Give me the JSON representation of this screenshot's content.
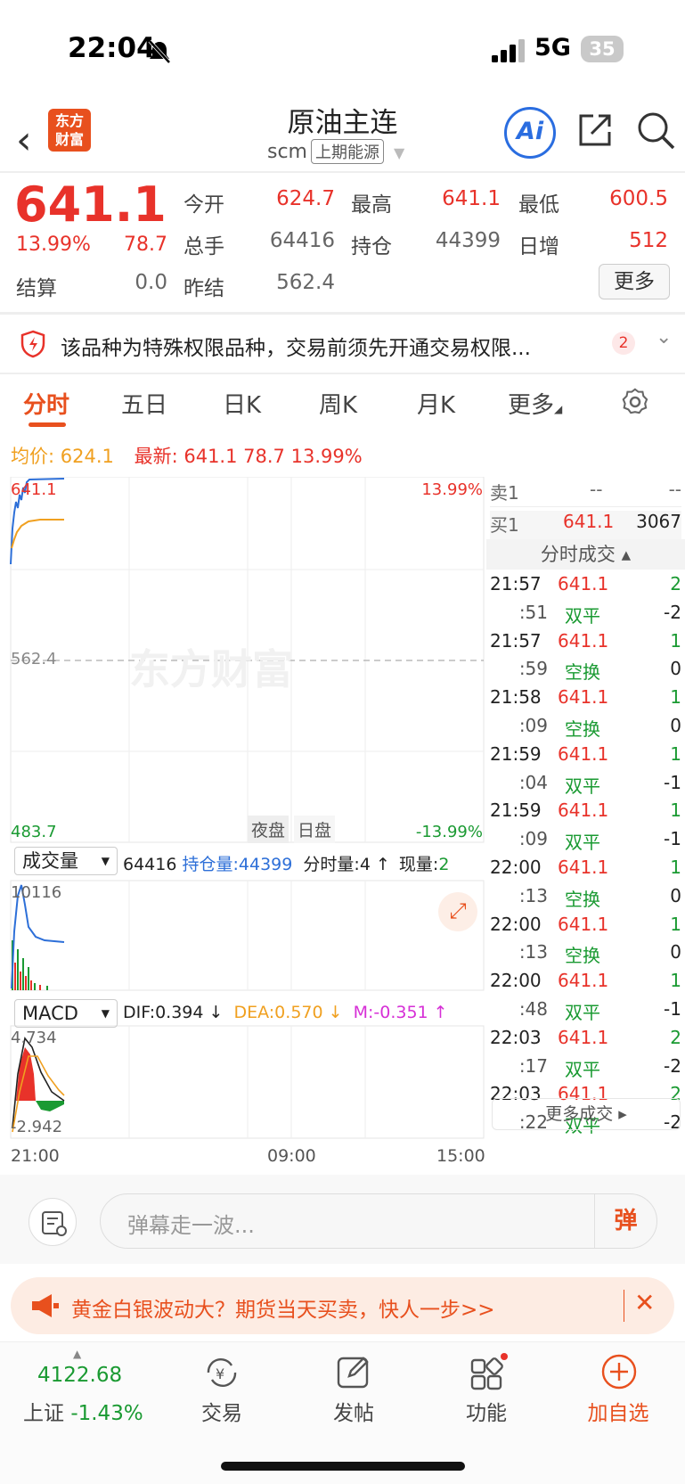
{
  "status_bar": {
    "time": "22:04",
    "network": "5G",
    "battery": "35"
  },
  "header": {
    "logo_text": "东方财富",
    "title": "原油主连",
    "symbol": "scm",
    "exchange": "上期能源"
  },
  "quote": {
    "price": "641.1",
    "change_pct": "13.99%",
    "change": "78.7",
    "fields": [
      {
        "label": "今开",
        "value": "624.7",
        "color": "red"
      },
      {
        "label": "最高",
        "value": "641.1",
        "color": "red"
      },
      {
        "label": "最低",
        "value": "600.5",
        "color": "red"
      },
      {
        "label": "总手",
        "value": "64416",
        "color": "gray"
      },
      {
        "label": "持仓",
        "value": "44399",
        "color": "gray"
      },
      {
        "label": "日增",
        "value": "512",
        "color": "red"
      },
      {
        "label": "结算",
        "value": "0.0",
        "color": "gray"
      },
      {
        "label": "昨结",
        "value": "562.4",
        "color": "gray"
      }
    ],
    "more_label": "更多"
  },
  "notice": {
    "text": "该品种为特殊权限品种，交易前须先开通交易权限...",
    "badge": "2"
  },
  "tabs": [
    "分时",
    "五日",
    "日K",
    "周K",
    "月K",
    "更多"
  ],
  "info_line": {
    "avg_label": "均价:",
    "avg_value": "624.1",
    "latest_label": "最新:",
    "latest_value": "641.1",
    "latest_change": "78.7",
    "latest_pct": "13.99%"
  },
  "chart": {
    "price_high": "641.1",
    "pct_high": "13.99%",
    "pre_settle": "562.4",
    "price_low": "483.7",
    "pct_low": "-13.99%",
    "watermark": "东方财富",
    "session_night": "夜盘",
    "session_day": "日盘",
    "volume_selector": "成交量",
    "volume_line": {
      "total": "64416",
      "oi_label": "持仓量:",
      "oi_value": "44399",
      "tick_label": "分时量:",
      "tick_value": "4",
      "cur_label": "现量:",
      "cur_value": "2"
    },
    "volume_max": "10116",
    "macd_selector": "MACD",
    "macd_line": {
      "dif": "DIF:0.394",
      "dea": "DEA:0.570",
      "m": "M:-0.351"
    },
    "macd_max": "4.734",
    "macd_min": "-2.942",
    "time_axis": [
      "21:00",
      "09:00",
      "15:00"
    ]
  },
  "order_book": [
    {
      "label": "卖1",
      "price": "--",
      "vol": "--"
    },
    {
      "label": "买1",
      "price": "641.1",
      "vol": "3067"
    }
  ],
  "ticks_header": "分时成交",
  "ticks": [
    {
      "time": "21:57",
      "price": "641.1",
      "vol": "2",
      "ptype": "price"
    },
    {
      "time": ":51",
      "price": "双平",
      "vol": "-2",
      "ptype": "type"
    },
    {
      "time": "21:57",
      "price": "641.1",
      "vol": "1",
      "ptype": "price"
    },
    {
      "time": ":59",
      "price": "空换",
      "vol": "0",
      "ptype": "type"
    },
    {
      "time": "21:58",
      "price": "641.1",
      "vol": "1",
      "ptype": "price"
    },
    {
      "time": ":09",
      "price": "空换",
      "vol": "0",
      "ptype": "type"
    },
    {
      "time": "21:59",
      "price": "641.1",
      "vol": "1",
      "ptype": "price"
    },
    {
      "time": ":04",
      "price": "双平",
      "vol": "-1",
      "ptype": "type"
    },
    {
      "time": "21:59",
      "price": "641.1",
      "vol": "1",
      "ptype": "price"
    },
    {
      "time": ":09",
      "price": "双平",
      "vol": "-1",
      "ptype": "type"
    },
    {
      "time": "22:00",
      "price": "641.1",
      "vol": "1",
      "ptype": "price"
    },
    {
      "time": ":13",
      "price": "空换",
      "vol": "0",
      "ptype": "type"
    },
    {
      "time": "22:00",
      "price": "641.1",
      "vol": "1",
      "ptype": "price"
    },
    {
      "time": ":13",
      "price": "空换",
      "vol": "0",
      "ptype": "type"
    },
    {
      "time": "22:00",
      "price": "641.1",
      "vol": "1",
      "ptype": "price"
    },
    {
      "time": ":48",
      "price": "双平",
      "vol": "-1",
      "ptype": "type"
    },
    {
      "time": "22:03",
      "price": "641.1",
      "vol": "2",
      "ptype": "price"
    },
    {
      "time": ":17",
      "price": "双平",
      "vol": "-2",
      "ptype": "type"
    },
    {
      "time": "22:03",
      "price": "641.1",
      "vol": "2",
      "ptype": "price"
    },
    {
      "time": ":22",
      "price": "双平",
      "vol": "-2",
      "ptype": "type"
    }
  ],
  "more_ticks": "更多成交",
  "danmu": {
    "placeholder": "弹幕走一波...",
    "button": "弹"
  },
  "promo": {
    "text": "黄金白银波动大？期货当天买卖，快人一步>>"
  },
  "bottom_nav": {
    "index_value": "4122.68",
    "index_name": "上证",
    "index_change": "-1.43%",
    "items": [
      "交易",
      "发帖",
      "功能",
      "加自选"
    ]
  }
}
